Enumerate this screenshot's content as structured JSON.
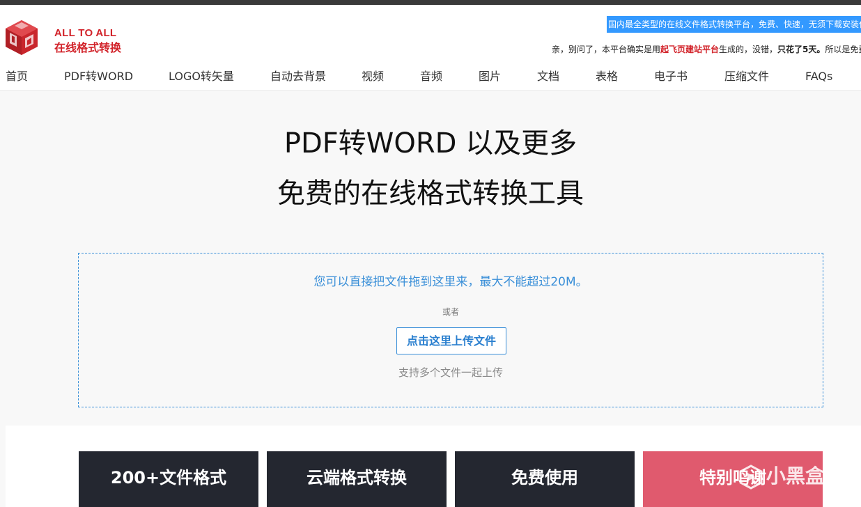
{
  "header": {
    "brand_line1": "ALL TO ALL",
    "brand_line2": "在线格式转换",
    "marquee_top": "国内最全类型的在线文件格式转换平台，免费、快速，无须下载安装任何软件",
    "marquee_bottom": {
      "part1": "亲，别问了，本平台确实是用",
      "part2": "起飞页建站平台",
      "part3": "生成的，没错，",
      "part4": "只花了5天。",
      "part5": "所以是免费的"
    }
  },
  "nav": {
    "items": [
      {
        "label": "首页"
      },
      {
        "label": "PDF转WORD"
      },
      {
        "label": "LOGO转矢量"
      },
      {
        "label": "自动去背景"
      },
      {
        "label": "视频"
      },
      {
        "label": "音频"
      },
      {
        "label": "图片"
      },
      {
        "label": "文档"
      },
      {
        "label": "表格"
      },
      {
        "label": "电子书"
      },
      {
        "label": "压缩文件"
      },
      {
        "label": "FAQs"
      }
    ]
  },
  "hero": {
    "title1": "PDF转WORD 以及更多",
    "title2": "免费的在线格式转换工具"
  },
  "upload": {
    "hint": "您可以直接把文件拖到这里来，最大不能超过20M。",
    "or": "或者",
    "button": "点击这里上传文件",
    "multi": "支持多个文件一起上传"
  },
  "features": [
    {
      "label": "200+文件格式"
    },
    {
      "label": "云端格式转换"
    },
    {
      "label": "免费使用"
    },
    {
      "label": "特别鸣谢"
    }
  ],
  "watermark": {
    "text": "小黑盒"
  },
  "colors": {
    "brand_red": "#d2232a",
    "accent_blue": "#3a8fd8",
    "dark_card": "#242730",
    "pink_card": "#e05a6e"
  }
}
